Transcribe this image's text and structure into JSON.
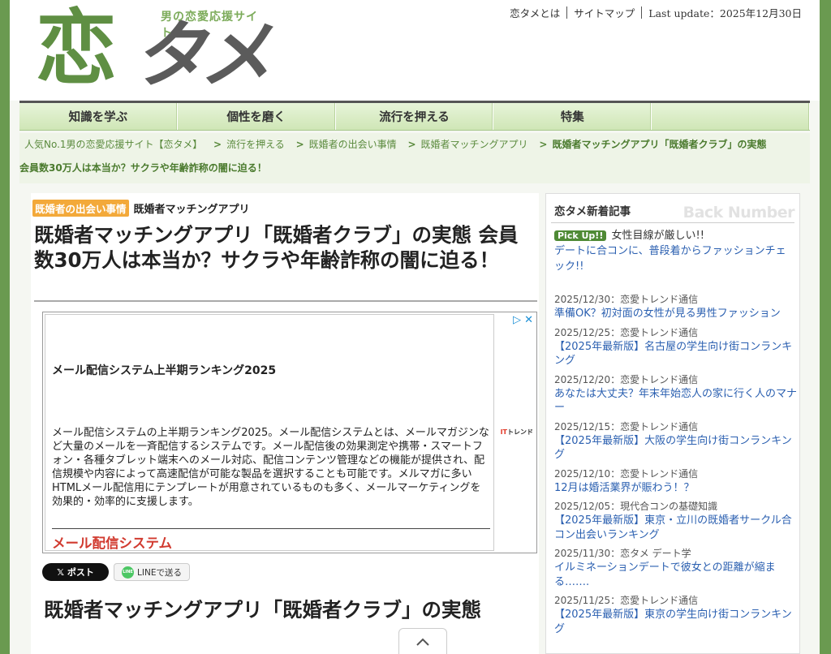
{
  "header": {
    "logo_tagline": "男の恋愛応援サイト",
    "logo_kanji": "恋",
    "logo_kana": "タメ",
    "top_links": [
      {
        "label": "恋タメとは"
      },
      {
        "label": "サイトマップ"
      }
    ],
    "last_update": "Last update：2025年12月30日"
  },
  "nav": {
    "items": [
      {
        "label": "知識を学ぶ"
      },
      {
        "label": "個性を磨く"
      },
      {
        "label": "流行を押える"
      },
      {
        "label": "特集"
      },
      {
        "label": ""
      }
    ]
  },
  "breadcrumb": {
    "items": [
      "人気No.1男の恋愛応援サイト【恋タメ】",
      "流行を押える",
      "既婚者の出会い事情",
      "既婚者マッチングアプリ"
    ],
    "current_line1": "既婚者マッチングアプリ「既婚者クラブ」の実態",
    "current_line2": "会員数30万人は本当か？サクラや年齢詐称の闇に迫る！",
    "separator": ">"
  },
  "article": {
    "category_badge": "既婚者の出会い事情",
    "subcategory": "既婚者マッチングアプリ",
    "title": "既婚者マッチングアプリ「既婚者クラブ」の実態 会員数30万人は本当か？サクラや年齢詐称の闇に迫る！",
    "section_title": "既婚者マッチングアプリ「既婚者クラブ」の実態"
  },
  "ad": {
    "heading": "メール配信システム上半期ランキング2025",
    "body": "メール配信システムの上半期ランキング2025。メール配信システムとは、メールマガジンなど大量のメールを一斉配信するシステムです。メール配信後の効果測定や携帯・スマートフォン・各種タブレット端末へのメール対応、配信コンテンツ管理などの機能が提供され、配信規模や内容によって高速配信が可能な製品を選択することも可能です。メルマガに多いHTMLメール配信用にテンプレートが用意されているものも多く、メールマーケティングを効果的・効率的に支援します。",
    "link_text": "メール配信システム",
    "brand_prefix": "IT",
    "brand_suffix": "トレンド",
    "choices_icon": "ad-choices-icon"
  },
  "share": {
    "post_label": "𝕏 ポスト",
    "line_label": "LINEで送る",
    "line_badge": "LINE"
  },
  "sidebar": {
    "title": "恋タメ新着記事",
    "back_number": "Back Number",
    "pickup_badge": "Pick Up!!",
    "pickup_note": "女性目線が厳しい!!",
    "pickup_link": "デートに合コンに、普段着からファッションチェック!!",
    "news": [
      {
        "meta": "2025/12/30：恋愛トレンド通信",
        "title": "準備OK？初対面の女性が見る男性ファッション"
      },
      {
        "meta": "2025/12/25：恋愛トレンド通信",
        "title": "【2025年最新版】名古屋の学生向け街コンランキング"
      },
      {
        "meta": "2025/12/20：恋愛トレンド通信",
        "title": "あなたは大丈夫？年末年始恋人の家に行く人のマナー"
      },
      {
        "meta": "2025/12/15：恋愛トレンド通信",
        "title": "【2025年最新版】大阪の学生向け街コンランキング"
      },
      {
        "meta": "2025/12/10：恋愛トレンド通信",
        "title": "12月は婚活業界が賑わう！？"
      },
      {
        "meta": "2025/12/05：現代合コンの基礎知識",
        "title": "【2025年最新版】東京・立川の既婚者サークル合コン出会いランキング"
      },
      {
        "meta": "2025/11/30：恋タメ デート学",
        "title": "イルミネーションデートで彼女との距離が縮まる……."
      },
      {
        "meta": "2025/11/25：恋愛トレンド通信",
        "title": "【2025年最新版】東京の学生向け街コンランキング"
      }
    ]
  },
  "to_top_icon": "chevron-up-icon"
}
